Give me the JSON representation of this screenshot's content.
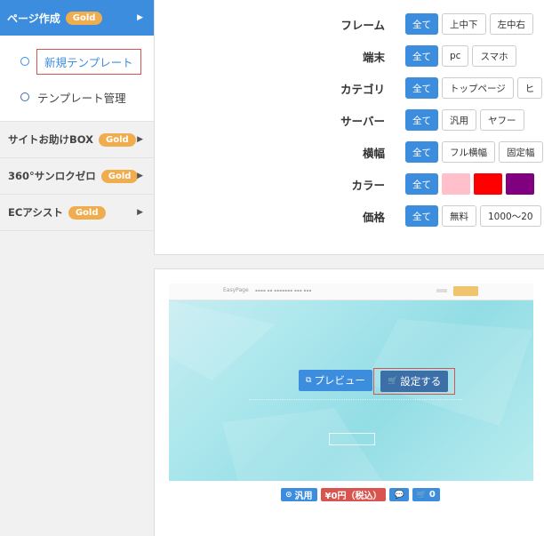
{
  "sidebar": {
    "gold_label": "Gold",
    "header": {
      "label": "ページ作成"
    },
    "sub_items": [
      {
        "label": "新規テンプレート",
        "active": true
      },
      {
        "label": "テンプレート管理",
        "active": false
      }
    ],
    "sections": [
      {
        "label": "サイトお助けBOX"
      },
      {
        "label": "360°サンロクゼロ"
      },
      {
        "label": "ECアシスト"
      }
    ]
  },
  "filters": {
    "frame": {
      "label": "フレーム",
      "options": [
        "全て",
        "上中下",
        "左中右"
      ]
    },
    "device": {
      "label": "端末",
      "options": [
        "全て",
        "pc",
        "スマホ"
      ]
    },
    "category": {
      "label": "カテゴリ",
      "options": [
        "全て",
        "トップページ",
        "ヒ"
      ]
    },
    "server": {
      "label": "サーバー",
      "options": [
        "全て",
        "汎用",
        "ヤフー"
      ]
    },
    "width": {
      "label": "横幅",
      "options": [
        "全て",
        "フル横幅",
        "固定幅"
      ]
    },
    "color": {
      "label": "カラー",
      "options": [
        "全て"
      ],
      "swatches": [
        "#ffc0cb",
        "#ff0000",
        "#800080"
      ]
    },
    "price": {
      "label": "価格",
      "options": [
        "全て",
        "無料",
        "1000〜20"
      ]
    }
  },
  "template": {
    "preview_button": "プレビュー",
    "set_button": "設定する",
    "preview_logo": "EasyPage",
    "badges": {
      "usage": "汎用",
      "price": "¥0円（税込）",
      "comments": "",
      "cart": "0"
    }
  },
  "colors": {
    "accent": "#3c8dde",
    "gold": "#f0ad4e",
    "price": "#d9534f"
  }
}
